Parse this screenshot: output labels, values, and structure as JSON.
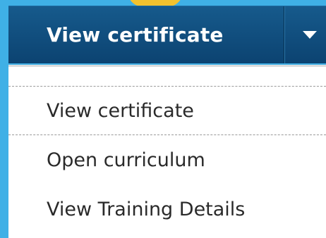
{
  "split_button": {
    "label": "View certificate",
    "toggle_icon": "caret-down-icon"
  },
  "menu": {
    "items": [
      {
        "label": "View certificate"
      },
      {
        "label": "Open curriculum"
      },
      {
        "label": "View Training Details"
      }
    ]
  },
  "colors": {
    "background": "#3fb0e6",
    "button": "#0c4371",
    "menu": "#ffffff",
    "text": "#2a2a2a"
  }
}
